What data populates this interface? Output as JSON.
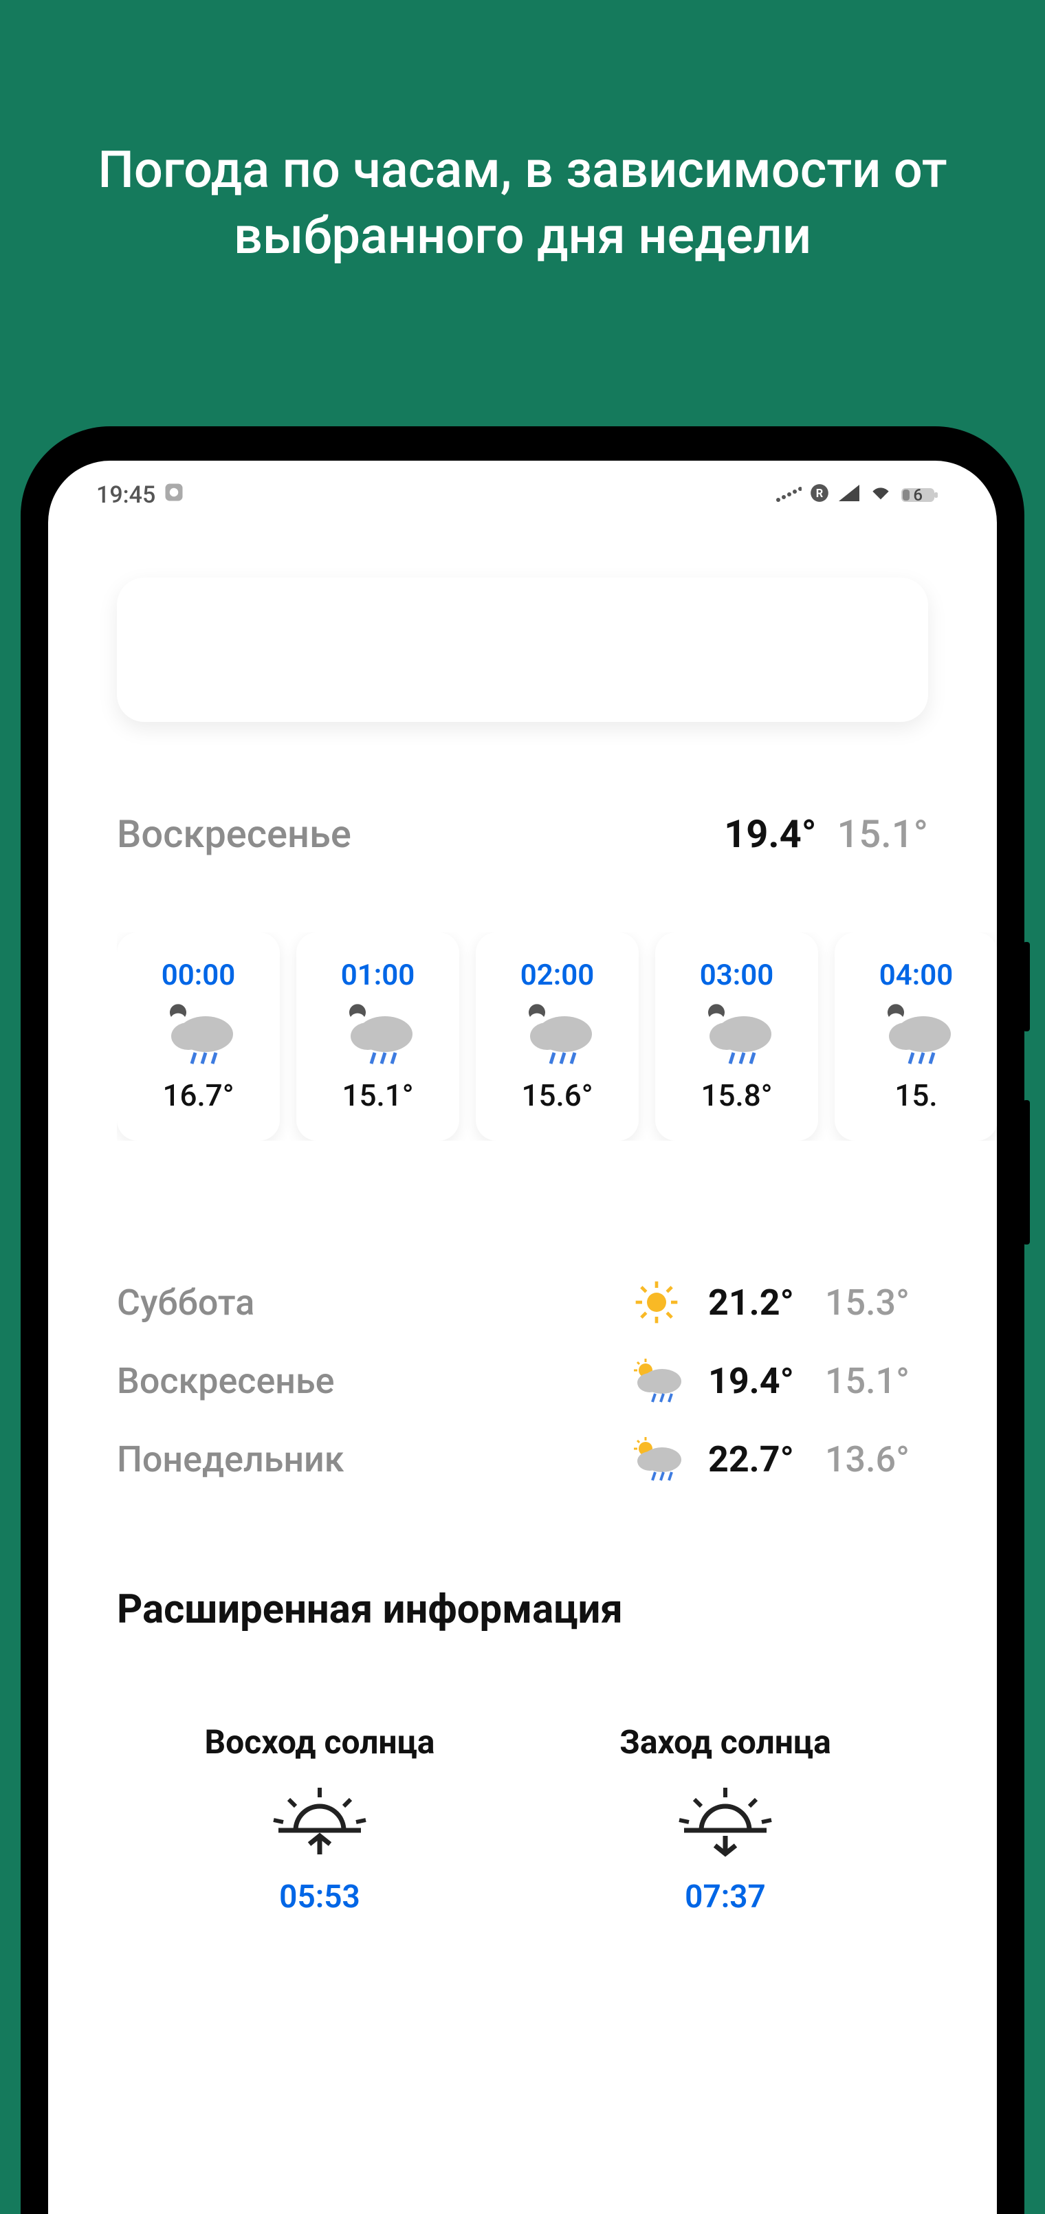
{
  "promo": {
    "title": "Погода по часам, в зависимости от выбранного дня недели"
  },
  "status_bar": {
    "time": "19:45",
    "battery_pct": "6"
  },
  "selected_day": {
    "name": "Воскресенье",
    "hi": "19.4°",
    "lo": "15.1°"
  },
  "hourly": [
    {
      "time": "00:00",
      "temp": "16.7°"
    },
    {
      "time": "01:00",
      "temp": "15.1°"
    },
    {
      "time": "02:00",
      "temp": "15.6°"
    },
    {
      "time": "03:00",
      "temp": "15.8°"
    },
    {
      "time": "04:00",
      "temp": "15."
    }
  ],
  "days": [
    {
      "name": "Суббота",
      "icon": "sun",
      "hi": "21.2°",
      "lo": "15.3°"
    },
    {
      "name": "Воскресенье",
      "icon": "sun-cloud-rain",
      "hi": "19.4°",
      "lo": "15.1°"
    },
    {
      "name": "Понедельник",
      "icon": "sun-cloud-rain",
      "hi": "22.7°",
      "lo": "13.6°"
    }
  ],
  "extended": {
    "title": "Расширенная информация",
    "sunrise_label": "Восход солнца",
    "sunrise_time": "05:53",
    "sunset_label": "Заход солнца",
    "sunset_time": "07:37"
  }
}
